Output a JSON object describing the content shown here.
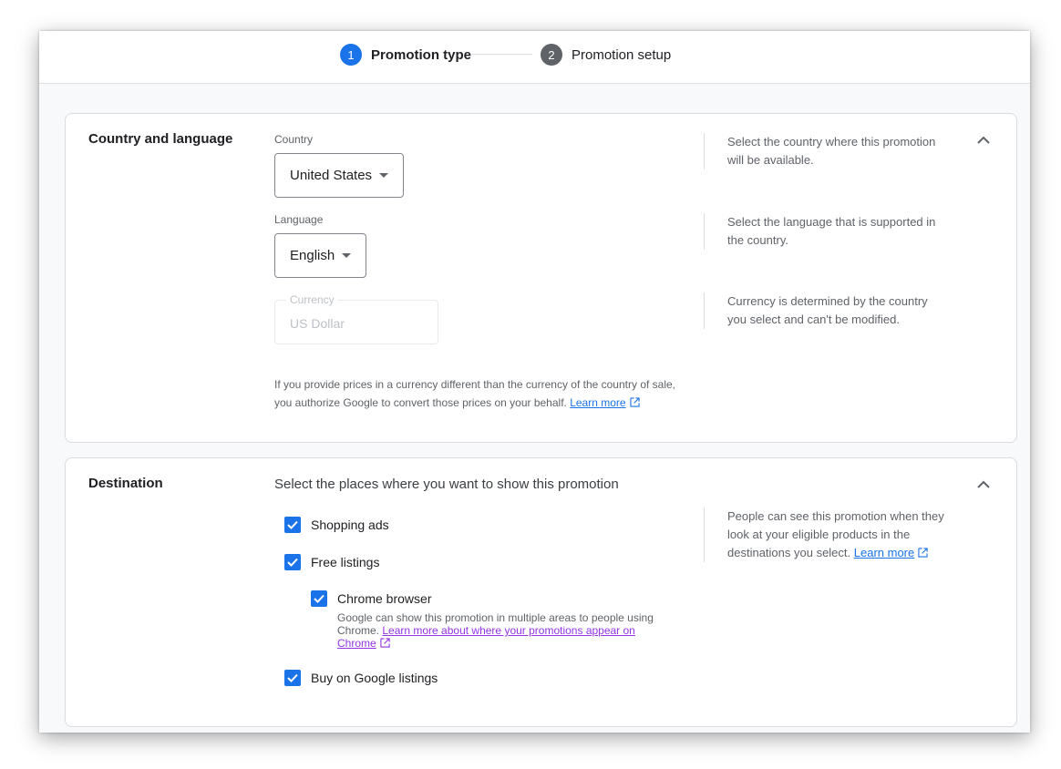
{
  "stepper": {
    "steps": [
      {
        "number": "1",
        "label": "Promotion type",
        "active": true
      },
      {
        "number": "2",
        "label": "Promotion setup",
        "active": false
      }
    ]
  },
  "country_language": {
    "title": "Country and language",
    "country": {
      "label": "Country",
      "value": "United States",
      "help": "Select the country where this promotion will be available."
    },
    "language": {
      "label": "Language",
      "value": "English",
      "help": "Select the language that is supported in the country."
    },
    "currency": {
      "label": "Currency",
      "value": "US Dollar",
      "help": "Currency is determined by the country you select and can't be modified."
    },
    "note_text": "If you provide prices in a currency different than the currency of the country of sale, you authorize Google to convert those prices on your behalf.",
    "note_link": "Learn more"
  },
  "destination": {
    "title": "Destination",
    "heading": "Select the places where you want to show this promotion",
    "help_text": "People can see this promotion when they look at your eligible products in the destinations you select.",
    "help_link": "Learn more",
    "options": {
      "shopping_ads": {
        "label": "Shopping ads",
        "checked": true
      },
      "free_listings": {
        "label": "Free listings",
        "checked": true
      },
      "chrome_browser": {
        "label": "Chrome browser",
        "checked": true,
        "description": "Google can show this promotion in multiple areas to people using Chrome.",
        "link": "Learn more about where your promotions appear on Chrome"
      },
      "buy_on_google": {
        "label": "Buy on Google listings",
        "checked": true
      }
    }
  },
  "colors": {
    "accent": "#1a73e8",
    "visited_link": "#9334e6",
    "step_inactive": "#5f6368"
  }
}
